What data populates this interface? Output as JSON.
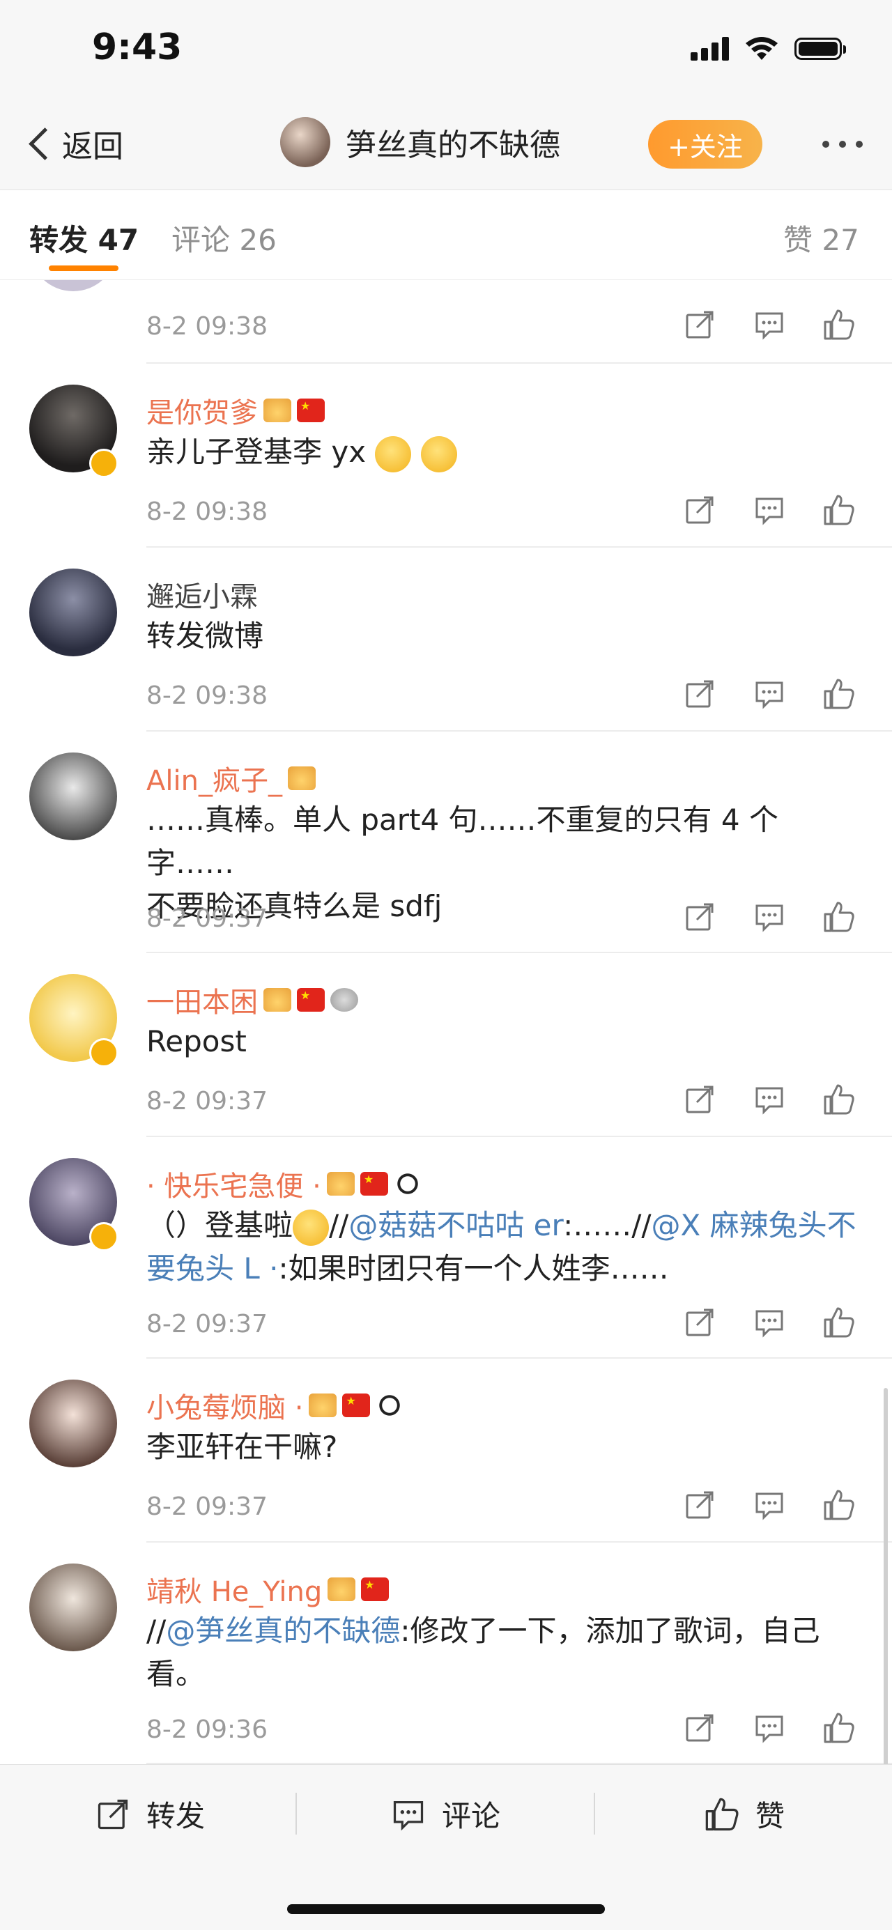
{
  "status_bar": {
    "time": "9:43"
  },
  "nav": {
    "back_label": "返回",
    "title": "笋丝真的不缺德",
    "follow_label": "+关注"
  },
  "tabs": [
    {
      "label": "转发 47",
      "active": true
    },
    {
      "label": "评论 26",
      "active": false
    },
    {
      "label": "赞 27",
      "active": false
    }
  ],
  "reposts": [
    {
      "user": "",
      "timestamp": "8-2 09:38"
    },
    {
      "user": "是你贺爹",
      "text": "亲儿子登基李 yx",
      "timestamp": "8-2 09:38",
      "verified": true,
      "badges": [
        "crown",
        "flag"
      ]
    },
    {
      "user": "邂逅小霖",
      "text": "转发微博",
      "timestamp": "8-2 09:38",
      "verified": false,
      "badges": []
    },
    {
      "user": "Alin_疯子_",
      "text_line1": "……真棒。单人 part4 句……不重复的只有 4 个字……",
      "text_line2": "不要脸还真特么是 sdfj",
      "timestamp": "8-2 09:37",
      "verified": false,
      "badges": [
        "crown"
      ]
    },
    {
      "user": "一田本困",
      "text": "Repost",
      "timestamp": "8-2 09:37",
      "verified": true,
      "badges": [
        "crown",
        "flag",
        "medal"
      ]
    },
    {
      "user": "· 快乐宅急便 ·",
      "text_parts": {
        "p1": "（）登基啦",
        "p2": "//",
        "mention1": "@菇菇不咕咕 er",
        "p3": ":……//",
        "mention2": "@X 麻辣兔头不要兔头 L ·",
        "p4": ":如果时团只有一个人姓李……"
      },
      "timestamp": "8-2 09:37",
      "verified": true,
      "badges": [
        "crown",
        "flag",
        "panda"
      ]
    },
    {
      "user": "小兔莓烦脑 ·",
      "text": "李亚轩在干嘛?",
      "timestamp": "8-2 09:37",
      "verified": false,
      "badges": [
        "crown",
        "flag",
        "panda"
      ]
    },
    {
      "user": "靖秋 He_Ying",
      "text_parts": {
        "p1": "//",
        "mention1": "@笋丝真的不缺德",
        "p2": ":修改了一下，添加了歌词，自己看。"
      },
      "timestamp": "8-2 09:36",
      "verified": false,
      "badges": [
        "crown",
        "flag"
      ]
    }
  ],
  "bottom_bar": {
    "repost_label": "转发",
    "comment_label": "评论",
    "like_label": "赞"
  },
  "icons": [
    "back-chevron-icon",
    "share-icon",
    "comment-icon",
    "like-icon"
  ],
  "colors": {
    "accent": "#ff8200",
    "username": "#eb7350",
    "link": "#4a7fb8"
  }
}
